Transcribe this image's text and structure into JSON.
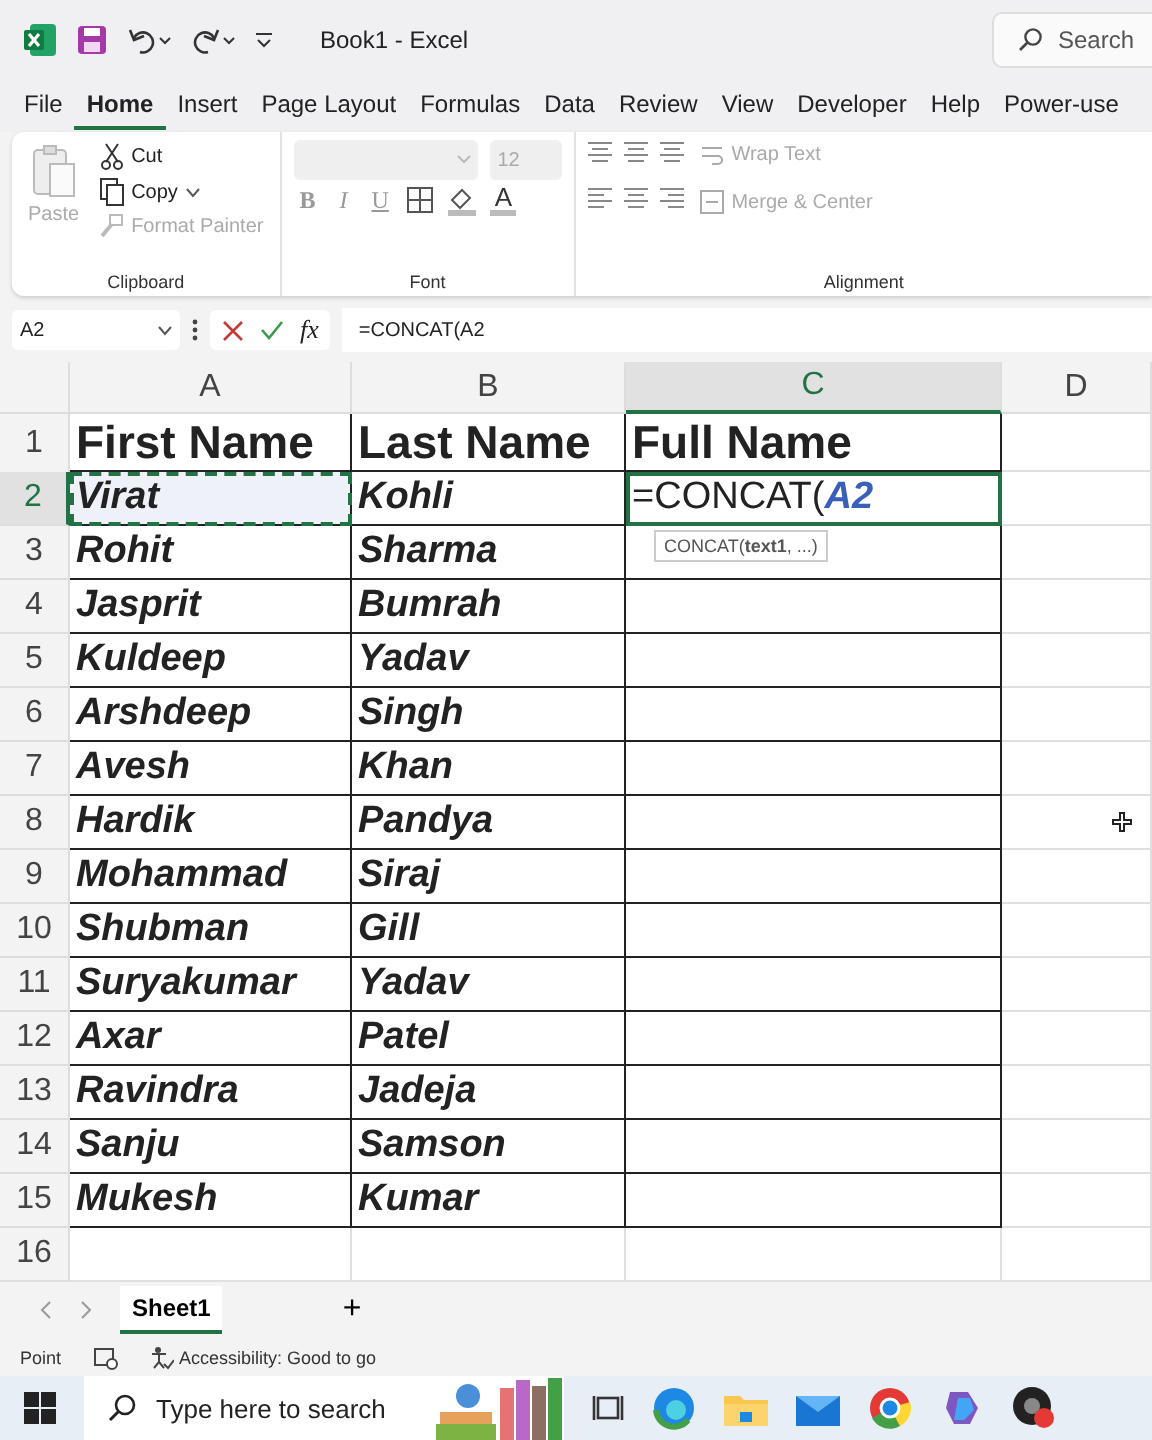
{
  "title_bar": {
    "title": "Book1  -  Excel",
    "search": "Search"
  },
  "menu_tabs": [
    {
      "label": "File",
      "selected": false
    },
    {
      "label": "Home",
      "selected": true
    },
    {
      "label": "Insert",
      "selected": false
    },
    {
      "label": "Page Layout",
      "selected": false
    },
    {
      "label": "Formulas",
      "selected": false
    },
    {
      "label": "Data",
      "selected": false
    },
    {
      "label": "Review",
      "selected": false
    },
    {
      "label": "View",
      "selected": false
    },
    {
      "label": "Developer",
      "selected": false
    },
    {
      "label": "Help",
      "selected": false
    },
    {
      "label": "Power-use",
      "selected": false
    }
  ],
  "ribbon": {
    "clipboard": {
      "paste": {
        "label": "Paste",
        "disabled": true
      },
      "cut": {
        "label": "Cut",
        "disabled": false
      },
      "copy": {
        "label": "Copy",
        "disabled": false
      },
      "format_painter": {
        "label": "Format Painter",
        "disabled": true
      },
      "label": "Clipboard"
    },
    "font": {
      "size": "12",
      "bold": "B",
      "italic": "I",
      "underline": "U",
      "font_color": "A",
      "label": "Font"
    },
    "alignment": {
      "wrap_text": {
        "label": "Wrap Text",
        "disabled": true
      },
      "merge": {
        "label": "Merge & Center",
        "disabled": true
      },
      "label": "Alignment"
    }
  },
  "formula_bar": {
    "name_box": "A2",
    "function_label": "fx",
    "formula": "=CONCAT(A2"
  },
  "sheet": {
    "columns": [
      {
        "label": "A",
        "selected": false
      },
      {
        "label": "B",
        "selected": false
      },
      {
        "label": "C",
        "selected": true
      },
      {
        "label": "D",
        "selected": false
      }
    ],
    "rows": [
      {
        "number": "1",
        "kind": "header",
        "selected": false,
        "cells": [
          "First Name",
          "Last Name",
          "Full Name"
        ]
      },
      {
        "number": "2",
        "kind": "data",
        "selected": true,
        "marked": true,
        "cells": [
          "Virat",
          "Kohli"
        ],
        "editing": {
          "text": "=CONCAT(",
          "reference": "A2",
          "tooltip": "CONCAT(**text1**, ...)"
        }
      },
      {
        "number": "3",
        "kind": "data",
        "selected": false,
        "cells": [
          "Rohit",
          "Sharma"
        ]
      },
      {
        "number": "4",
        "kind": "data",
        "selected": false,
        "cells": [
          "Jasprit",
          "Bumrah"
        ]
      },
      {
        "number": "5",
        "kind": "data",
        "selected": false,
        "cells": [
          "Kuldeep",
          "Yadav"
        ]
      },
      {
        "number": "6",
        "kind": "data",
        "selected": false,
        "cells": [
          "Arshdeep",
          "Singh"
        ]
      },
      {
        "number": "7",
        "kind": "data",
        "selected": false,
        "cells": [
          "Avesh",
          "Khan"
        ]
      },
      {
        "number": "8",
        "kind": "data",
        "selected": false,
        "cells": [
          "Hardik",
          "Pandya"
        ]
      },
      {
        "number": "9",
        "kind": "data",
        "selected": false,
        "cells": [
          "Mohammad",
          "Siraj"
        ]
      },
      {
        "number": "10",
        "kind": "data",
        "selected": false,
        "cells": [
          "Shubman",
          "Gill"
        ]
      },
      {
        "number": "11",
        "kind": "data",
        "selected": false,
        "cells": [
          "Suryakumar",
          "Yadav"
        ]
      },
      {
        "number": "12",
        "kind": "data",
        "selected": false,
        "cells": [
          "Axar",
          "Patel"
        ]
      },
      {
        "number": "13",
        "kind": "data",
        "selected": false,
        "cells": [
          "Ravindra",
          "Jadeja"
        ]
      },
      {
        "number": "14",
        "kind": "data",
        "selected": false,
        "cells": [
          "Sanju",
          "Samson"
        ]
      },
      {
        "number": "15",
        "kind": "data",
        "selected": false,
        "cells": [
          "Mukesh",
          "Kumar"
        ]
      },
      {
        "number": "16",
        "kind": "empty",
        "selected": false,
        "cells": []
      }
    ]
  },
  "sheet_tabs": [
    {
      "label": "Sheet1",
      "selected": true
    }
  ],
  "add_sheet": "+",
  "status_bar": {
    "mode": "Point",
    "accessibility": "Accessibility: Good to go"
  },
  "taskbar": {
    "search_placeholder": "Type here to search"
  }
}
